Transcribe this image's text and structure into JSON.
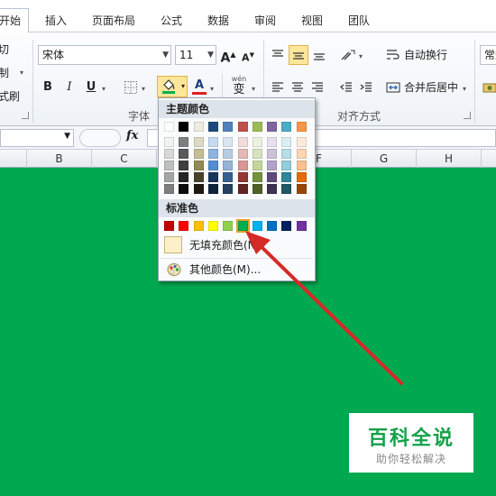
{
  "ribbon_tabs": [
    {
      "label": "开始",
      "active": true
    },
    {
      "label": "插入",
      "active": false
    },
    {
      "label": "页面布局",
      "active": false
    },
    {
      "label": "公式",
      "active": false
    },
    {
      "label": "数据",
      "active": false
    },
    {
      "label": "审阅",
      "active": false
    },
    {
      "label": "视图",
      "active": false
    },
    {
      "label": "团队",
      "active": false
    }
  ],
  "clipboard": {
    "cut": "剪切",
    "copy": "复制",
    "painter": "格式刷"
  },
  "font_group": {
    "font_name": "宋体",
    "font_size": "11",
    "grow": "A",
    "shrink": "A",
    "bold": "B",
    "italic": "I",
    "underline": "U",
    "font_color_glyph": "A",
    "phonetic": "wén",
    "phonetic_char": "变",
    "label": "字体"
  },
  "alignment_group": {
    "wrap_text": "自动换行",
    "merge_center": "合并后居中",
    "label": "对齐方式"
  },
  "number_group": {
    "format": "常规"
  },
  "formula_bar": {
    "fx": "fx"
  },
  "columns": [
    "B",
    "C",
    "F",
    "G",
    "H"
  ],
  "color_popup": {
    "theme_title": "主题颜色",
    "standard_title": "标准色",
    "no_fill": "无填充颜色(N)",
    "more_colors": "其他颜色(M)...",
    "theme_colors": [
      [
        "#FFFFFF",
        "#F2F2F2",
        "#D8D8D8",
        "#BFBFBF",
        "#A5A5A5",
        "#7F7F7F"
      ],
      [
        "#000000",
        "#7F7F7F",
        "#595959",
        "#3F3F3F",
        "#262626",
        "#0C0C0C"
      ],
      [
        "#EEECE1",
        "#DDD9C3",
        "#C4BD97",
        "#938953",
        "#494429",
        "#1D1B10"
      ],
      [
        "#1F497D",
        "#C6D9F0",
        "#8DB3E2",
        "#548DD4",
        "#17365D",
        "#0F243E"
      ],
      [
        "#4F81BD",
        "#DBE5F1",
        "#B8CCE4",
        "#95B3D7",
        "#366092",
        "#244061"
      ],
      [
        "#C0504D",
        "#F2DCDB",
        "#E5B9B7",
        "#D99694",
        "#953734",
        "#632423"
      ],
      [
        "#9BBB59",
        "#EBF1DD",
        "#D7E3BC",
        "#C3D69B",
        "#76923C",
        "#4F6128"
      ],
      [
        "#8064A2",
        "#E5E0EC",
        "#CCC1D9",
        "#B2A2C7",
        "#5F497A",
        "#3F3151"
      ],
      [
        "#4BACC6",
        "#DBEEF3",
        "#B7DDE8",
        "#92CDDC",
        "#31859B",
        "#205867"
      ],
      [
        "#F79646",
        "#FDEADA",
        "#FBD5B5",
        "#FAC08F",
        "#E36C09",
        "#974806"
      ]
    ],
    "standard_colors": [
      "#C00000",
      "#FF0000",
      "#FFC000",
      "#FFFF00",
      "#92D050",
      "#00B050",
      "#00B0F0",
      "#0070C0",
      "#002060",
      "#7030A0"
    ],
    "selected_standard": "#00B050"
  },
  "sheet": {
    "fill_color": "#00A94F"
  },
  "watermark": {
    "title": "百科全说",
    "subtitle": "助你轻松解决"
  },
  "annotation": {
    "arrow_color": "#D42B27"
  }
}
